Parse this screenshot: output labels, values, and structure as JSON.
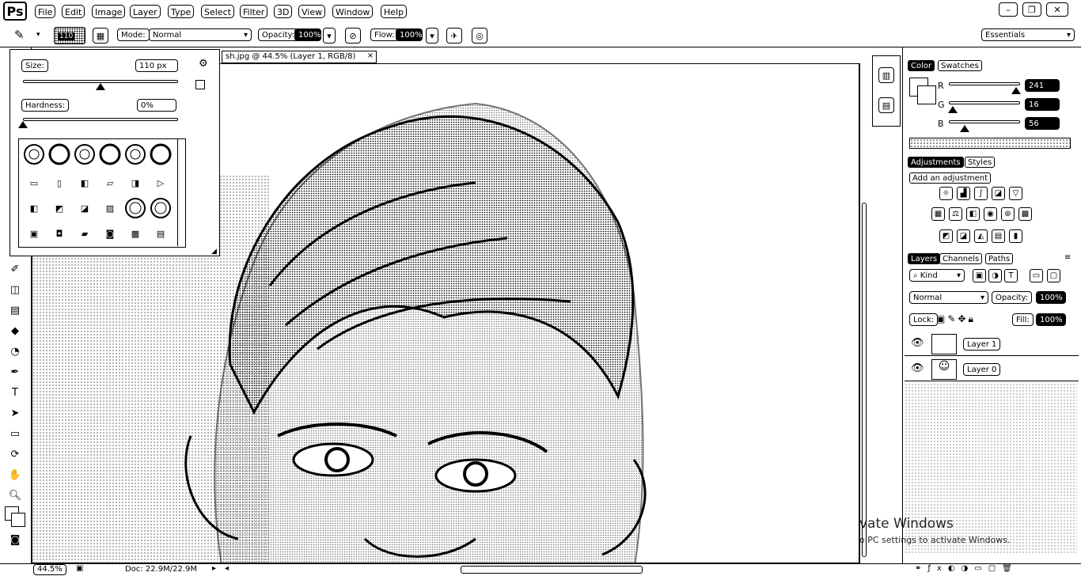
{
  "app": {
    "logo": "Ps"
  },
  "menu": [
    "File",
    "Edit",
    "Image",
    "Layer",
    "Type",
    "Select",
    "Filter",
    "3D",
    "View",
    "Window",
    "Help"
  ],
  "window_controls": {
    "minimize": "–",
    "restore": "❐",
    "close": "✕"
  },
  "options_bar": {
    "brush_size": "110",
    "mode_label": "Mode:",
    "mode_value": "Normal",
    "opacity_label": "Opacity:",
    "opacity_value": "100%",
    "flow_label": "Flow:",
    "flow_value": "100%",
    "workspace": "Essentials"
  },
  "brush_picker": {
    "size_label": "Size:",
    "size_value": "110 px",
    "size_level": 0.5,
    "hardness_label": "Hardness:",
    "hardness_value": "0%",
    "hardness_level": 0.0
  },
  "document": {
    "tab_title": "sh.jpg @ 44.5% (Layer 1, RGB/8)",
    "tab_close": "×"
  },
  "color_panel": {
    "tabs": [
      "Color",
      "Swatches"
    ],
    "channels": [
      {
        "label": "R",
        "value": "241",
        "level": 0.94
      },
      {
        "label": "G",
        "value": "16",
        "level": 0.06
      },
      {
        "label": "B",
        "value": "56",
        "level": 0.22
      }
    ]
  },
  "adjustments_panel": {
    "tabs": [
      "Adjustments",
      "Styles"
    ],
    "heading": "Add an adjustment"
  },
  "layers_panel": {
    "tabs": [
      "Layers",
      "Channels",
      "Paths"
    ],
    "kind_label": "Kind",
    "blend_mode": "Normal",
    "opacity_label": "Opacity:",
    "opacity_value": "100%",
    "lock_label": "Lock:",
    "fill_label": "Fill:",
    "fill_value": "100%",
    "layers": [
      {
        "name": "Layer 1"
      },
      {
        "name": "Layer 0"
      }
    ]
  },
  "status_bar": {
    "zoom": "44.5%",
    "doc_info": "Doc: 22.9M/22.9M"
  },
  "watermark": {
    "line1": "vate Windows",
    "line2": "o PC settings to activate Windows."
  }
}
